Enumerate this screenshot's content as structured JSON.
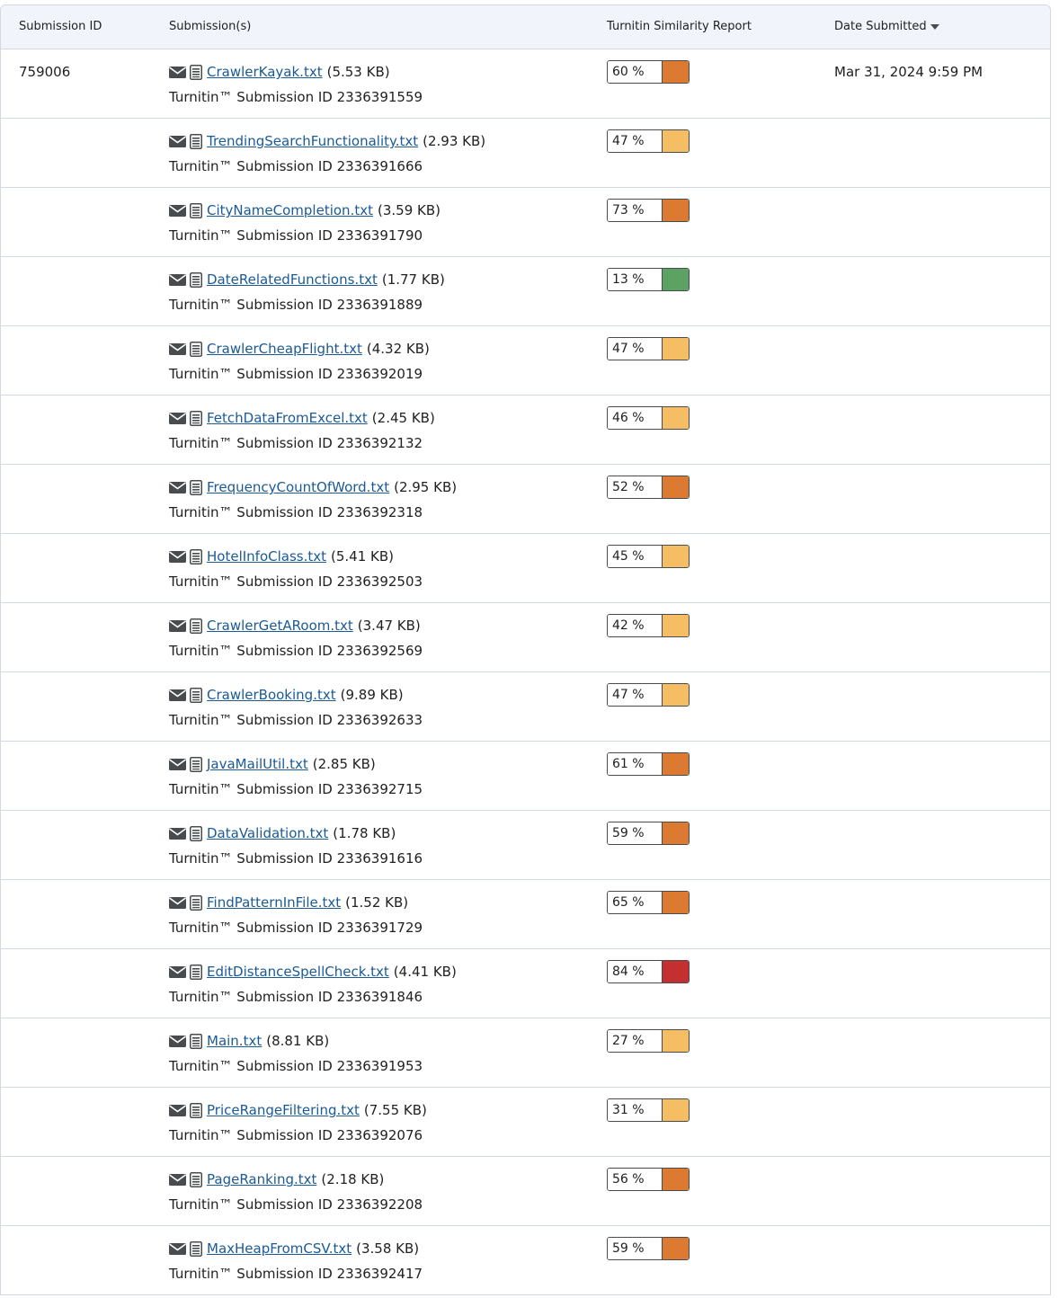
{
  "table": {
    "headers": {
      "submission_id": "Submission ID",
      "submissions": "Submission(s)",
      "report": "Turnitin Similarity Report",
      "date": "Date Submitted"
    },
    "submission_id": "759006",
    "date_submitted": "Mar 31, 2024 9:59 PM",
    "tii_prefix": "Turnitin™ Submission ID",
    "colors": {
      "high": "#c42f2f",
      "medium_high": "#dc7a32",
      "medium": "#f5bd64",
      "low": "#5ba263"
    },
    "rows": [
      {
        "file": "CrawlerKayak.txt",
        "size": "(5.53 KB)",
        "tii": "Turnitin™ Submission ID 2336391559",
        "pct": "60 %",
        "color": "#dc7a32"
      },
      {
        "file": "TrendingSearchFunctionality.txt",
        "size": "(2.93 KB)",
        "tii": "Turnitin™ Submission ID 2336391666",
        "pct": "47 %",
        "color": "#f5bd64"
      },
      {
        "file": "CityNameCompletion.txt",
        "size": "(3.59 KB)",
        "tii": "Turnitin™ Submission ID 2336391790",
        "pct": "73 %",
        "color": "#dc7a32"
      },
      {
        "file": "DateRelatedFunctions.txt",
        "size": "(1.77 KB)",
        "tii": "Turnitin™ Submission ID 2336391889",
        "pct": "13 %",
        "color": "#5ba263"
      },
      {
        "file": "CrawlerCheapFlight.txt",
        "size": "(4.32 KB)",
        "tii": "Turnitin™ Submission ID 2336392019",
        "pct": "47 %",
        "color": "#f5bd64"
      },
      {
        "file": "FetchDataFromExcel.txt",
        "size": "(2.45 KB)",
        "tii": "Turnitin™ Submission ID 2336392132",
        "pct": "46 %",
        "color": "#f5bd64"
      },
      {
        "file": "FrequencyCountOfWord.txt",
        "size": "(2.95 KB)",
        "tii": "Turnitin™ Submission ID 2336392318",
        "pct": "52 %",
        "color": "#dc7a32"
      },
      {
        "file": "HotelInfoClass.txt",
        "size": "(5.41 KB)",
        "tii": "Turnitin™ Submission ID 2336392503",
        "pct": "45 %",
        "color": "#f5bd64"
      },
      {
        "file": "CrawlerGetARoom.txt",
        "size": "(3.47 KB)",
        "tii": "Turnitin™ Submission ID 2336392569",
        "pct": "42 %",
        "color": "#f5bd64"
      },
      {
        "file": "CrawlerBooking.txt",
        "size": "(9.89 KB)",
        "tii": "Turnitin™ Submission ID 2336392633",
        "pct": "47 %",
        "color": "#f5bd64"
      },
      {
        "file": "JavaMailUtil.txt",
        "size": "(2.85 KB)",
        "tii": "Turnitin™ Submission ID 2336392715",
        "pct": "61 %",
        "color": "#dc7a32"
      },
      {
        "file": "DataValidation.txt",
        "size": "(1.78 KB)",
        "tii": "Turnitin™ Submission ID 2336391616",
        "pct": "59 %",
        "color": "#dc7a32"
      },
      {
        "file": "FindPatternInFile.txt",
        "size": "(1.52 KB)",
        "tii": "Turnitin™ Submission ID 2336391729",
        "pct": "65 %",
        "color": "#dc7a32"
      },
      {
        "file": "EditDistanceSpellCheck.txt",
        "size": "(4.41 KB)",
        "tii": "Turnitin™ Submission ID 2336391846",
        "pct": "84 %",
        "color": "#c42f2f"
      },
      {
        "file": "Main.txt",
        "size": "(8.81 KB)",
        "tii": "Turnitin™ Submission ID 2336391953",
        "pct": "27 %",
        "color": "#f5bd64"
      },
      {
        "file": "PriceRangeFiltering.txt",
        "size": "(7.55 KB)",
        "tii": "Turnitin™ Submission ID 2336392076",
        "pct": "31 %",
        "color": "#f5bd64"
      },
      {
        "file": "PageRanking.txt",
        "size": "(2.18 KB)",
        "tii": "Turnitin™ Submission ID 2336392208",
        "pct": "56 %",
        "color": "#dc7a32"
      },
      {
        "file": "MaxHeapFromCSV.txt",
        "size": "(3.58 KB)",
        "tii": "Turnitin™ Submission ID 2336392417",
        "pct": "59 %",
        "color": "#dc7a32"
      }
    ]
  }
}
